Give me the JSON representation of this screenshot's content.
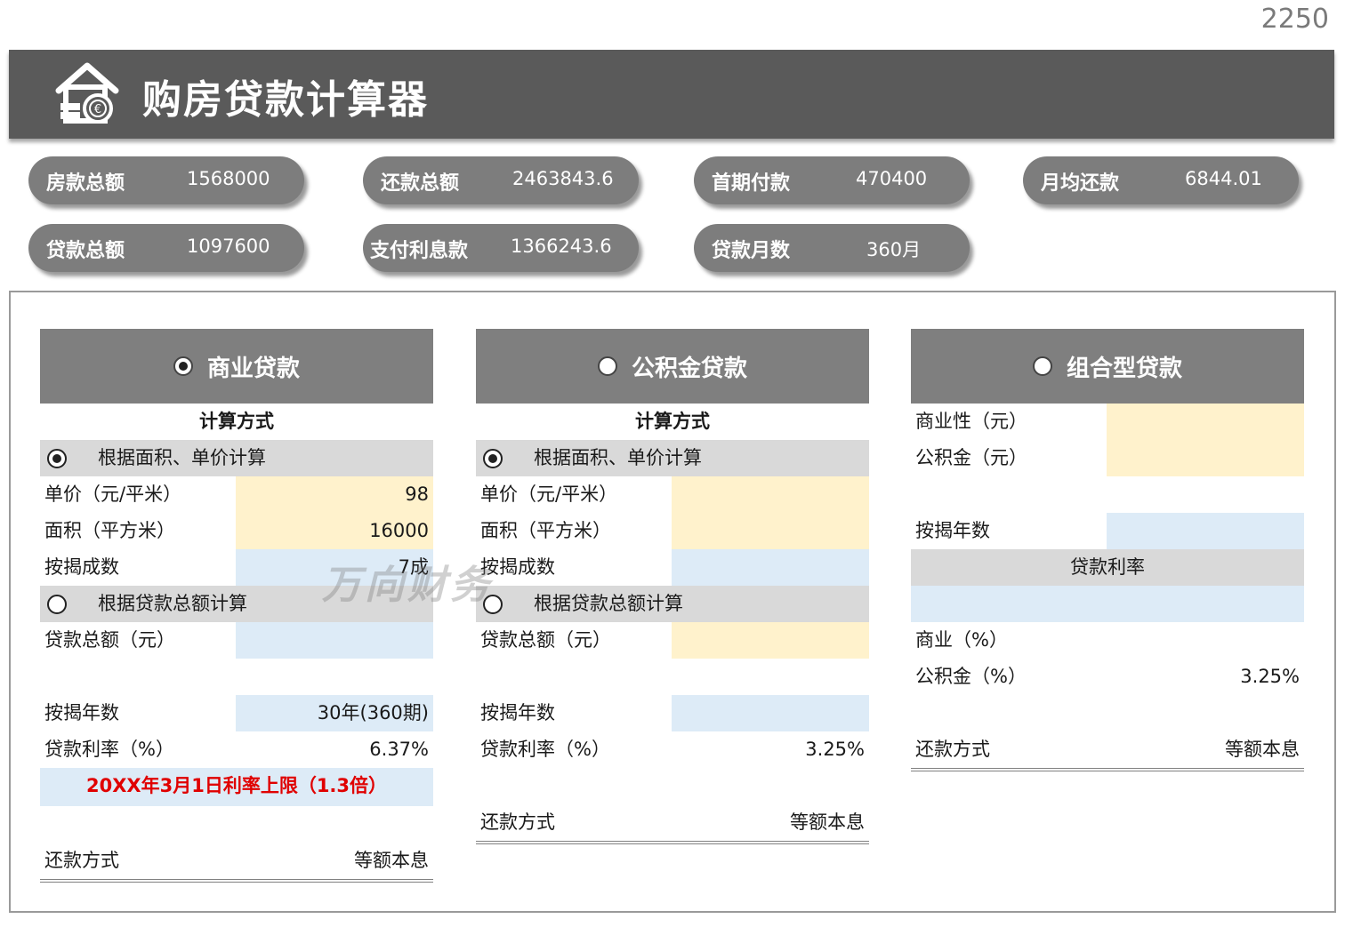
{
  "page_number": "2250",
  "title": "购房贷款计算器",
  "summary": [
    {
      "label": "房款总额",
      "value": "1568000"
    },
    {
      "label": "还款总额",
      "value": "2463843.6"
    },
    {
      "label": "首期付款",
      "value": "470400"
    },
    {
      "label": "月均还款",
      "value": "6844.01"
    },
    {
      "label": "贷款总额",
      "value": "1097600"
    },
    {
      "label": "支付利息款",
      "value": "1366243.6"
    },
    {
      "label": "贷款月数",
      "value": "360月"
    }
  ],
  "commercial": {
    "title": "商业贷款",
    "method_title": "计算方式",
    "by_area_label": "根据面积、单价计算",
    "unit_price_label": "单价（元/平米）",
    "unit_price_value": "98",
    "area_label": "面积（平方米）",
    "area_value": "16000",
    "ratio_label": "按揭成数",
    "ratio_value": "7成",
    "by_total_label": "根据贷款总额计算",
    "loan_total_label": "贷款总额（元）",
    "loan_total_value": "",
    "years_label": "按揭年数",
    "years_value": "30年(360期)",
    "rate_label": "贷款利率（%）",
    "rate_value": "6.37%",
    "note": "20XX年3月1日利率上限（1.3倍）",
    "repay_label": "还款方式",
    "repay_value": "等额本息"
  },
  "fund": {
    "title": "公积金贷款",
    "method_title": "计算方式",
    "by_area_label": "根据面积、单价计算",
    "unit_price_label": "单价（元/平米）",
    "area_label": "面积（平方米）",
    "ratio_label": "按揭成数",
    "by_total_label": "根据贷款总额计算",
    "loan_total_label": "贷款总额（元）",
    "years_label": "按揭年数",
    "rate_label": "贷款利率（%）",
    "rate_value": "3.25%",
    "repay_label": "还款方式",
    "repay_value": "等额本息"
  },
  "combined": {
    "title": "组合型贷款",
    "commercial_label": "商业性（元）",
    "fund_label": "公积金（元）",
    "years_label": "按揭年数",
    "rate_title": "贷款利率",
    "commercial_rate_label": "商业（%）",
    "fund_rate_label": "公积金（%）",
    "fund_rate_value": "3.25%",
    "repay_label": "还款方式",
    "repay_value": "等额本息"
  },
  "watermark": "万向财务",
  "colors": {
    "header": "#5a5a5a",
    "pill": "#7d7d7d",
    "input_yellow": "#fff2cc",
    "input_blue": "#ddebf7",
    "note_red": "#e00000"
  }
}
